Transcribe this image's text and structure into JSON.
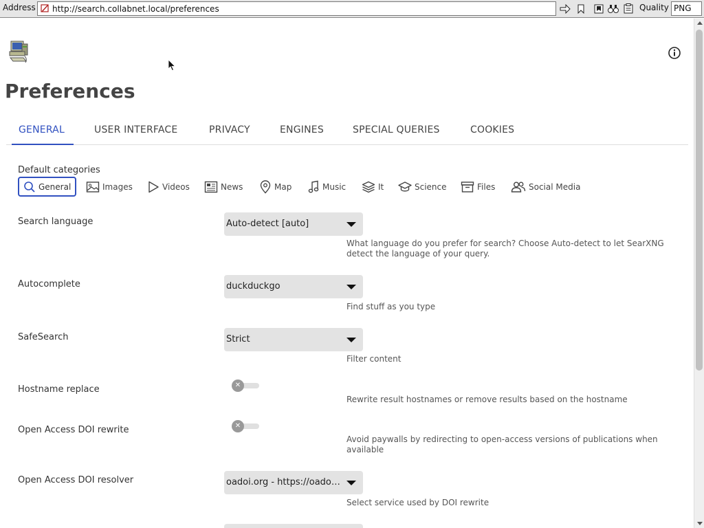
{
  "browser": {
    "address_label": "Address",
    "url": "http://search.collabnet.local/preferences",
    "quality_label": "Quality",
    "quality_value": "PNG"
  },
  "page": {
    "title": "Preferences",
    "tabs": [
      {
        "label": "GENERAL",
        "active": true
      },
      {
        "label": "USER INTERFACE"
      },
      {
        "label": "PRIVACY"
      },
      {
        "label": "ENGINES"
      },
      {
        "label": "SPECIAL QUERIES"
      },
      {
        "label": "COOKIES"
      }
    ],
    "categories_heading": "Default categories",
    "categories": [
      {
        "label": "General",
        "icon": "search-icon",
        "active": true
      },
      {
        "label": "Images",
        "icon": "image-icon"
      },
      {
        "label": "Videos",
        "icon": "play-icon"
      },
      {
        "label": "News",
        "icon": "newspaper-icon"
      },
      {
        "label": "Map",
        "icon": "map-pin-icon"
      },
      {
        "label": "Music",
        "icon": "music-icon"
      },
      {
        "label": "It",
        "icon": "layers-icon"
      },
      {
        "label": "Science",
        "icon": "school-icon"
      },
      {
        "label": "Files",
        "icon": "archive-icon"
      },
      {
        "label": "Social Media",
        "icon": "people-icon"
      }
    ],
    "settings": {
      "search_language": {
        "label": "Search language",
        "value": "Auto-detect [auto]",
        "help": "What language do you prefer for search? Choose Auto-detect to let SearXNG detect the language of your query."
      },
      "autocomplete": {
        "label": "Autocomplete",
        "value": "duckduckgo",
        "help": "Find stuff as you type"
      },
      "safesearch": {
        "label": "SafeSearch",
        "value": "Strict",
        "help": "Filter content"
      },
      "hostname_replace": {
        "label": "Hostname replace",
        "enabled": false,
        "help": "Rewrite result hostnames or remove results based on the hostname"
      },
      "oa_doi_rewrite": {
        "label": "Open Access DOI rewrite",
        "enabled": false,
        "help": "Avoid paywalls by redirecting to open-access versions of publications when available"
      },
      "oa_doi_resolver": {
        "label": "Open Access DOI resolver",
        "value": "oadoi.org - https://oadoi.org/",
        "help": "Select service used by DOI rewrite"
      }
    }
  },
  "colors": {
    "accent": "#3050c0",
    "select_bg": "#e3e3e3"
  }
}
